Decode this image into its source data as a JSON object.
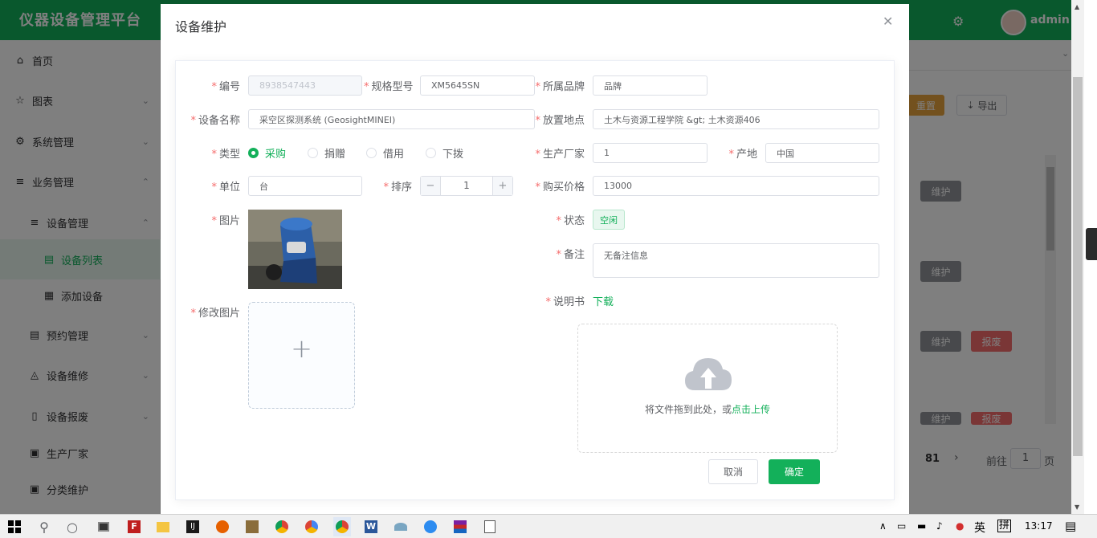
{
  "app": {
    "title": "仪器设备管理平台",
    "user": "admin"
  },
  "sidebar": {
    "items": [
      {
        "label": "首页",
        "icon": "home-icon"
      },
      {
        "label": "图表",
        "icon": "star-icon"
      },
      {
        "label": "系统管理",
        "icon": "gear-icon"
      },
      {
        "label": "业务管理",
        "icon": "menu-icon"
      },
      {
        "label": "设备管理",
        "icon": "menu-icon"
      },
      {
        "label": "设备列表",
        "icon": "document-icon"
      },
      {
        "label": "添加设备",
        "icon": "add-document-icon"
      },
      {
        "label": "预约管理",
        "icon": "document-icon"
      },
      {
        "label": "设备维修",
        "icon": "repair-icon"
      },
      {
        "label": "设备报废",
        "icon": "trash-icon"
      },
      {
        "label": "生产厂家",
        "icon": "factory-icon"
      },
      {
        "label": "分类维护",
        "icon": "category-icon"
      }
    ]
  },
  "background": {
    "reset": "重置",
    "export": "导出",
    "row_actions": [
      "维护",
      "维护",
      "维护",
      "报废",
      "维护",
      "报废"
    ],
    "pager": {
      "total": "81",
      "goto": "前往",
      "page": "1",
      "page_suffix": "页"
    }
  },
  "dialog": {
    "title": "设备维护",
    "fields": {
      "code": {
        "label": "编号",
        "value": "8938547443"
      },
      "model": {
        "label": "规格型号",
        "value": "XM5645SN"
      },
      "brand": {
        "label": "所属品牌",
        "value": "品牌"
      },
      "name": {
        "label": "设备名称",
        "value": "采空区探测系统 (GeosightMINEI)"
      },
      "location": {
        "label": "放置地点",
        "value": "土木与资源工程学院 &gt; 土木资源406"
      },
      "type": {
        "label": "类型",
        "options": [
          "采购",
          "捐赠",
          "借用",
          "下拨"
        ],
        "selected": "采购"
      },
      "manufacturer": {
        "label": "生产厂家",
        "value": "1"
      },
      "origin": {
        "label": "产地",
        "value": "中国"
      },
      "unit": {
        "label": "单位",
        "value": "台"
      },
      "order": {
        "label": "排序",
        "value": "1",
        "minus": "−",
        "plus": "+"
      },
      "price": {
        "label": "购买价格",
        "value": "13000"
      },
      "image": {
        "label": "图片"
      },
      "status": {
        "label": "状态",
        "value": "空闲"
      },
      "remark": {
        "label": "备注",
        "value": "无备注信息"
      },
      "edit_image": {
        "label": "修改图片",
        "plus": "+"
      },
      "manual": {
        "label": "说明书",
        "link": "下载"
      }
    },
    "upload": {
      "hint": "将文件拖到此处，或",
      "action": "点击上传"
    },
    "cancel": "取消",
    "confirm": "确定"
  },
  "taskbar": {
    "ime": "英",
    "layout": "拼",
    "time": "13:17"
  },
  "colors": {
    "primary": "#13b05a",
    "danger": "#f56c6c",
    "warning": "#e6a23c",
    "info": "#909399"
  }
}
